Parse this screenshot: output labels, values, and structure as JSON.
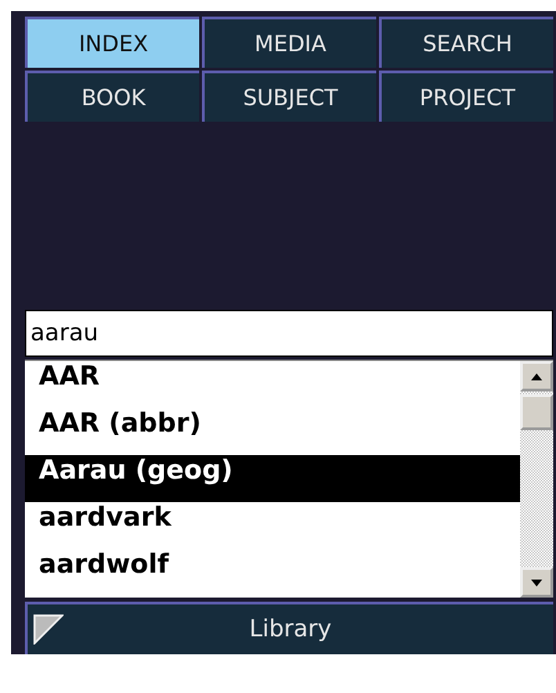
{
  "tabs": [
    {
      "label": "INDEX",
      "selected": true
    },
    {
      "label": "MEDIA",
      "selected": false
    },
    {
      "label": "SEARCH",
      "selected": false
    },
    {
      "label": "BOOK",
      "selected": false
    },
    {
      "label": "SUBJECT",
      "selected": false
    },
    {
      "label": "PROJECT",
      "selected": false
    }
  ],
  "search": {
    "value": "aarau"
  },
  "results": [
    {
      "label": "AAR",
      "selected": false
    },
    {
      "label": "AAR (abbr)",
      "selected": false
    },
    {
      "label": "Aarau (geog)",
      "selected": true
    },
    {
      "label": "aardvark",
      "selected": false
    },
    {
      "label": "aardwolf",
      "selected": false
    }
  ],
  "footer": {
    "label": "Library"
  }
}
